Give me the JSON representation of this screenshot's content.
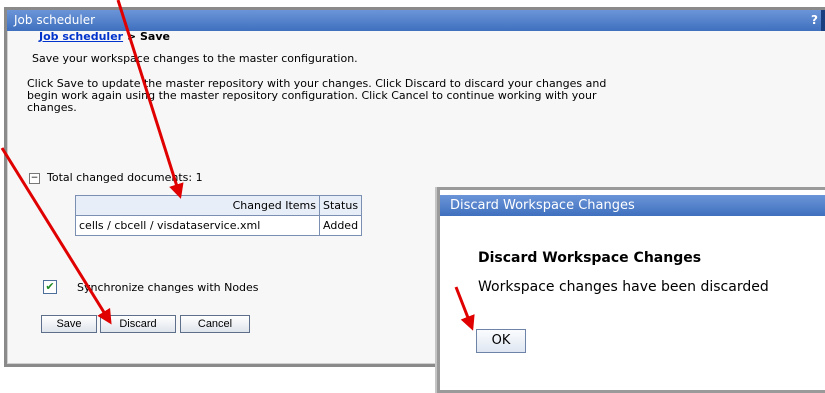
{
  "panel": {
    "title": "Job scheduler",
    "help_icon": "?",
    "minimize_icon": "–"
  },
  "breadcrumb": {
    "link": "Job scheduler",
    "separator": " > ",
    "current": "Save"
  },
  "intro_text": "Save your workspace changes to the master configuration.",
  "instructions": [
    "Click Save to update the master repository with your changes. Click Discard to discard your changes and",
    "begin work again using the master repository configuration. Click Cancel to continue working with your",
    "changes."
  ],
  "total_changed": "Total changed documents: 1",
  "collapse_symbol": "−",
  "table": {
    "headers": [
      "Changed Items",
      "Status"
    ],
    "rows": [
      [
        "cells / cbcell / visdataservice.xml",
        "Added"
      ]
    ]
  },
  "sync_checkbox": {
    "checked_mark": "✔",
    "label": "Synchronize changes with Nodes"
  },
  "buttons": {
    "save": "Save",
    "discard": "Discard",
    "cancel": "Cancel"
  },
  "dialog": {
    "title": "Discard Workspace Changes",
    "heading": "Discard Workspace Changes",
    "message": "Workspace changes have been discarded",
    "ok": "OK"
  },
  "colors": {
    "titlebar": "#3f70be",
    "link": "#0033cc",
    "arrow": "#e00000"
  }
}
